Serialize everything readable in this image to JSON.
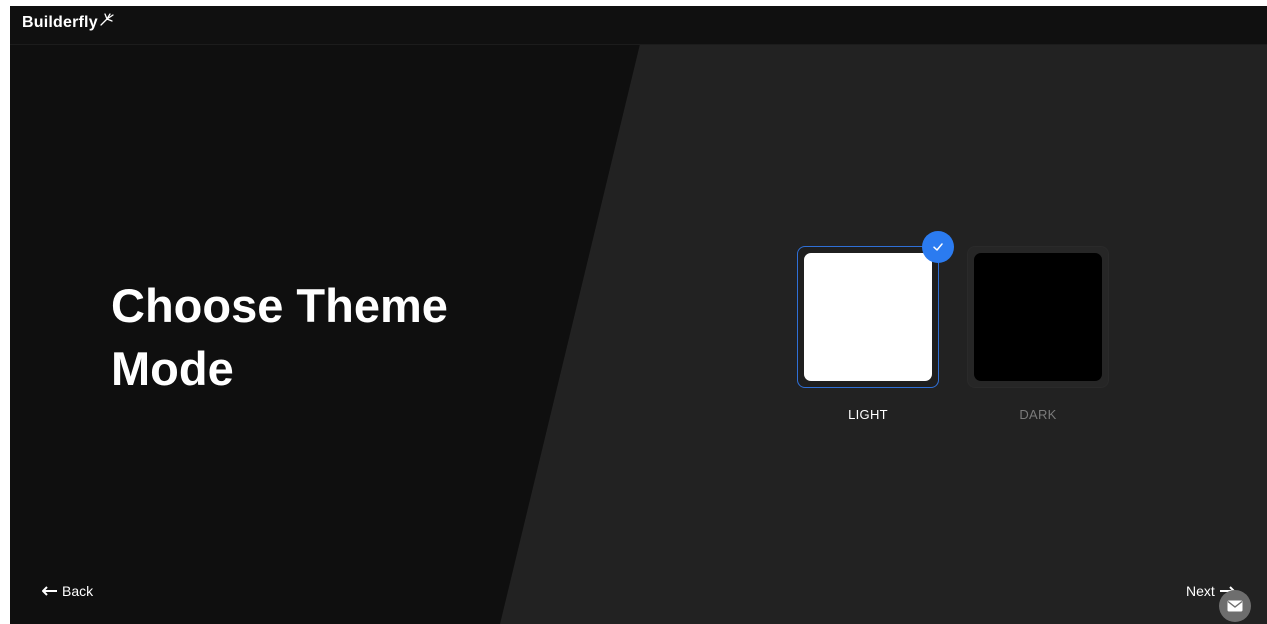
{
  "app": {
    "logo_text": "Builderfly"
  },
  "main": {
    "title_line1": "Choose Theme",
    "title_line2": "Mode"
  },
  "theme_options": [
    {
      "label": "LIGHT",
      "selected": true,
      "swatch_color": "#ffffff"
    },
    {
      "label": "DARK",
      "selected": false,
      "swatch_color": "#000000"
    }
  ],
  "nav": {
    "back_label": "Back",
    "next_label": "Next"
  },
  "colors": {
    "accent": "#2b7bf0",
    "left_bg": "#0f0f0f",
    "right_bg": "#222222"
  },
  "icons": {
    "back": "arrow-left-icon",
    "next": "arrow-right-icon",
    "check": "check-icon",
    "chat": "mail-icon"
  }
}
